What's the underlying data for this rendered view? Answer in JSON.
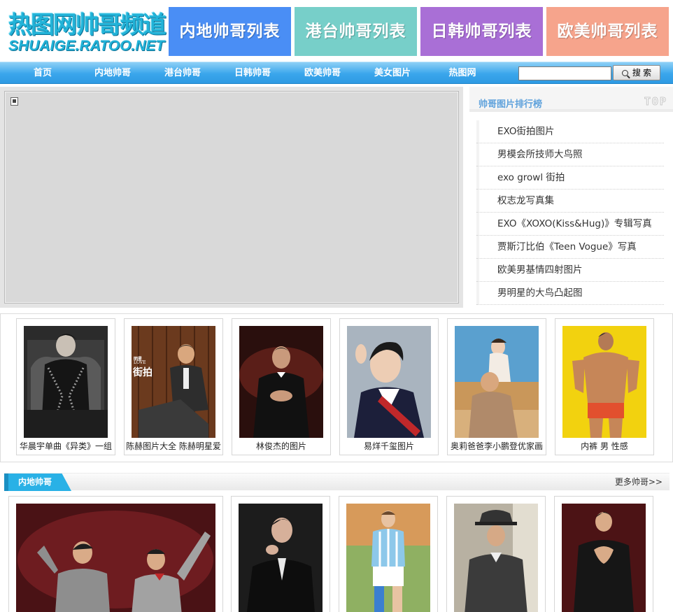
{
  "header": {
    "logo_cn": "热图网帅哥频道",
    "logo_en": "SHUAIGE.RATOO.NET",
    "banners": [
      {
        "label": "内地帅哥列表",
        "color": "#4a8ef5"
      },
      {
        "label": "港台帅哥列表",
        "color": "#77cfc9"
      },
      {
        "label": "日韩帅哥列表",
        "color": "#a96fd6"
      },
      {
        "label": "欧美帅哥列表",
        "color": "#f6a48c"
      }
    ]
  },
  "nav": {
    "items": [
      "首页",
      "内地帅哥",
      "港台帅哥",
      "日韩帅哥",
      "欧美帅哥",
      "美女图片",
      "热图网"
    ],
    "search_value": "",
    "search_button": "搜 索"
  },
  "ranking": {
    "title": "帅哥图片排行榜",
    "top_label": "TOP",
    "items": [
      "EXO街拍图片",
      "男模会所技师大鸟照",
      "exo growl 街拍",
      "权志龙写真集",
      "EXO《XOXO(Kiss&Hug)》专辑写真",
      "贾斯汀比伯《Teen Vogue》写真",
      "欧美男基情四射图片",
      "男明星的大鸟凸起图"
    ]
  },
  "strip1": {
    "cards": [
      {
        "caption": "华晨宇单曲《异类》一组",
        "overlay": ""
      },
      {
        "caption": "陈赫图片大全 陈赫明星爱",
        "overlay_top": "明星",
        "overlay_mid": "LOVE",
        "overlay_big": "街拍"
      },
      {
        "caption": "林俊杰的图片",
        "overlay": ""
      },
      {
        "caption": "易烊千玺图片",
        "overlay": ""
      },
      {
        "caption": "奥莉爸爸李小鹏登优家画",
        "overlay": ""
      },
      {
        "caption": "内裤 男 性感",
        "overlay": ""
      }
    ]
  },
  "section2": {
    "tab_label": "内地帅哥",
    "more_label": "更多帅哥>>"
  },
  "colors": {
    "nav_blue": "#3aa6ec",
    "ranking_title": "#5fa2dc",
    "section_tab": "#29b1e6"
  }
}
